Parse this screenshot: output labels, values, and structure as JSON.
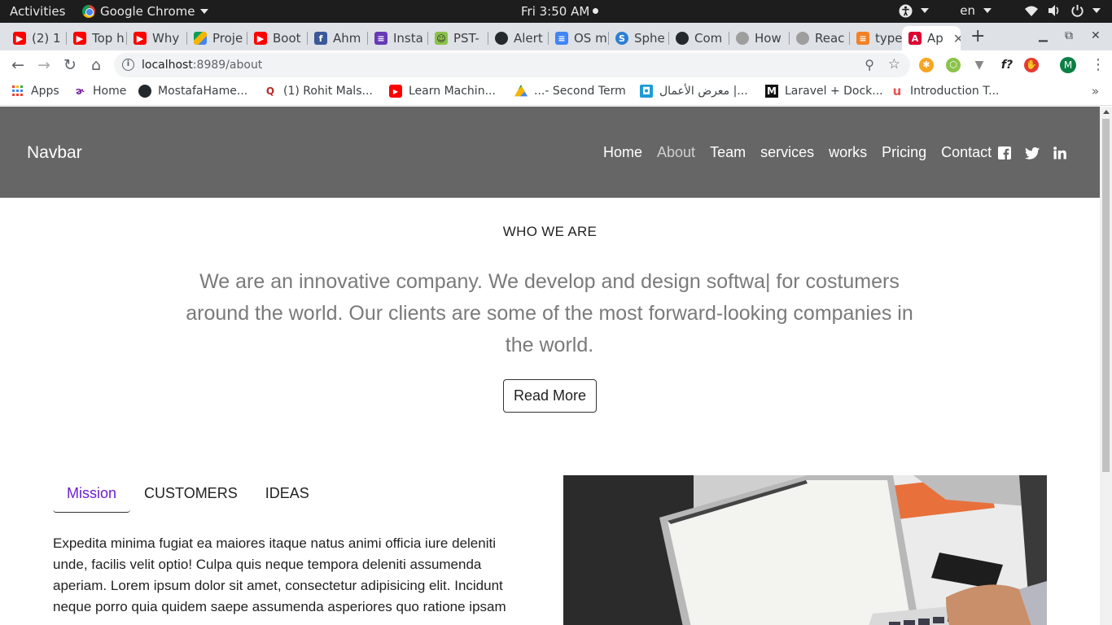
{
  "os_bar": {
    "activities": "Activities",
    "app_name": "Google Chrome",
    "clock": "Fri  3:50 AM",
    "language": "en"
  },
  "tabs": [
    {
      "title": "(2) 1",
      "favicon": "youtube-icon"
    },
    {
      "title": "Top h",
      "favicon": "youtube-icon"
    },
    {
      "title": "Why",
      "favicon": "youtube-icon"
    },
    {
      "title": "Proje",
      "favicon": "google-drive-icon"
    },
    {
      "title": "Boot",
      "favicon": "youtube-icon"
    },
    {
      "title": "Ahm",
      "favicon": "facebook-icon"
    },
    {
      "title": "Insta",
      "favicon": "forms-icon"
    },
    {
      "title": "PST-",
      "favicon": "smiley-icon"
    },
    {
      "title": "Alert",
      "favicon": "github-icon"
    },
    {
      "title": "OS m",
      "favicon": "docs-icon"
    },
    {
      "title": "Sphe",
      "favicon": "sphere-icon"
    },
    {
      "title": "Com",
      "favicon": "github-icon"
    },
    {
      "title": "How",
      "favicon": "globe-icon"
    },
    {
      "title": "Reac",
      "favicon": "globe-icon"
    },
    {
      "title": "type",
      "favicon": "stackoverflow-icon"
    },
    {
      "title": "Ap",
      "favicon": "angular-icon",
      "active": true
    }
  ],
  "address_bar": {
    "host": "localhost",
    "path": ":8989/about"
  },
  "profile_initial": "M",
  "bookmarks": [
    {
      "label": "Apps",
      "icon": "apps-grid-icon"
    },
    {
      "label": "Home",
      "icon": "home-bookmark-icon"
    },
    {
      "label": "MostafaHame...",
      "icon": "github-icon"
    },
    {
      "label": "(1) Rohit Mals...",
      "icon": "quora-icon"
    },
    {
      "label": "Learn Machin...",
      "icon": "youtube-icon"
    },
    {
      "label": "...- Second Term",
      "icon": "google-drive-icon"
    },
    {
      "label": "معرض الأعمال |...",
      "icon": "portfolio-icon"
    },
    {
      "label": "Laravel + Dock...",
      "icon": "medium-icon"
    },
    {
      "label": "Introduction T...",
      "icon": "udemy-icon"
    }
  ],
  "site": {
    "brand": "Navbar",
    "nav_links": [
      "Home",
      "About",
      "Team",
      "services",
      "works",
      "Pricing",
      "Contact"
    ],
    "active_link": "About",
    "social": [
      "facebook-icon",
      "twitter-icon",
      "linkedin-icon"
    ],
    "section_heading": "WHO WE ARE",
    "lead_text": "We are an innovative company. We develop and design softwa| for costumers around the world. Our clients are some of the most forward-looking companies in the world.",
    "read_more": "Read More",
    "tabs": [
      "Mission",
      "CUSTOMERS",
      "IDEAS"
    ],
    "active_tab": "Mission",
    "mission_text": "Expedita minima fugiat ea maiores itaque natus animi officia iure deleniti unde, facilis velit optio! Culpa quis neque tempora deleniti assumenda aperiam. Lorem ipsum dolor sit amet, consectetur adipisicing elit. Incidunt neque porro quia quidem saepe assumenda asperiores quo ratione ipsam",
    "colors": {
      "navbar_bg": "#666666",
      "active_tab": "#6a1fd1"
    }
  }
}
